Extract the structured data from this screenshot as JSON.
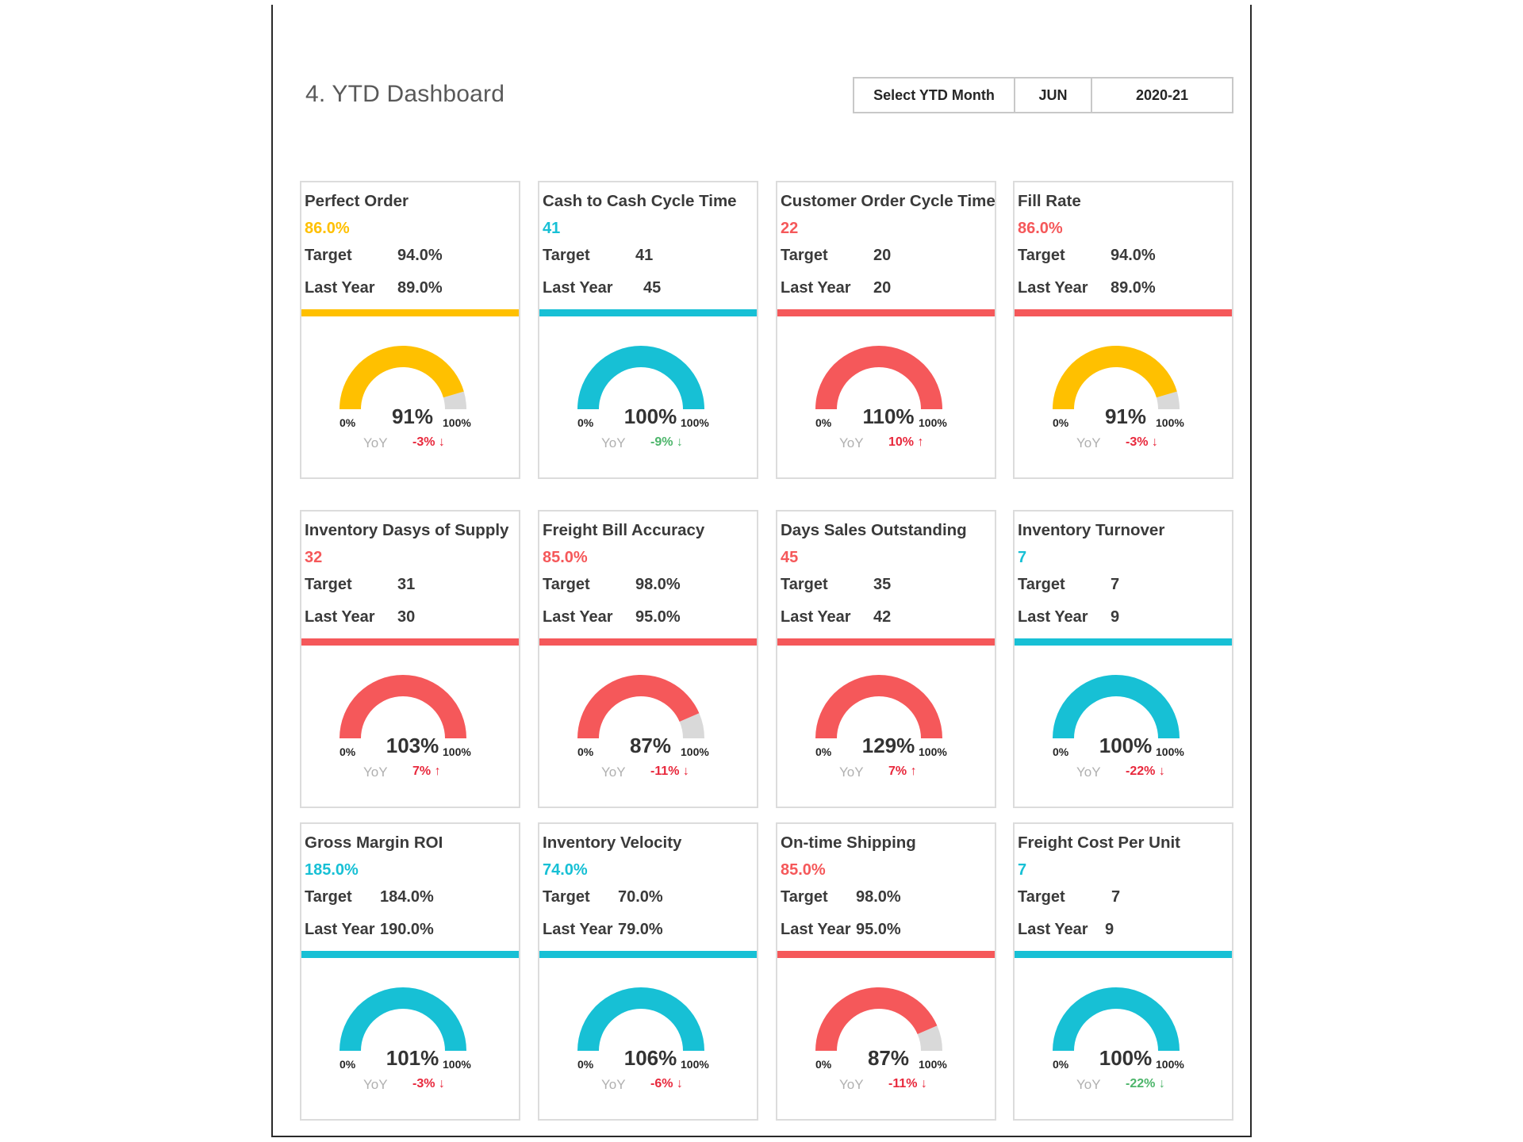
{
  "header": {
    "title": "4. YTD Dashboard"
  },
  "selector": {
    "label": "Select YTD Month",
    "month": "JUN",
    "year": "2020-21"
  },
  "colors": {
    "yellow": "#FFC000",
    "cyan": "#17C0D5",
    "red": "#F5585A",
    "gauge_rest": "#D9D9D9",
    "yoy_bad": "#E8283C",
    "yoy_good": "#4CB56A"
  },
  "labels": {
    "target": "Target",
    "last_year": "Last Year",
    "gauge_min": "0%",
    "gauge_max": "100%",
    "yoy": "YoY"
  },
  "cards": [
    {
      "title": "Perfect Order",
      "value": "86.0%",
      "target": "94.0%",
      "last_year": "89.0%",
      "status": "yellow",
      "gauge_label": "91%",
      "gauge_fraction": 0.91,
      "yoy": "-3%",
      "yoy_arrow": "down",
      "yoy_status": "bad"
    },
    {
      "title": "Cash to Cash Cycle Time",
      "value": "41",
      "target": "41",
      "last_year": "45",
      "status": "cyan",
      "gauge_label": "100%",
      "gauge_fraction": 1.0,
      "yoy": "-9%",
      "yoy_arrow": "down",
      "yoy_status": "good"
    },
    {
      "title": "Customer Order Cycle Time",
      "value": "22",
      "target": "20",
      "last_year": "20",
      "status": "red",
      "gauge_label": "110%",
      "gauge_fraction": 1.1,
      "yoy": "10%",
      "yoy_arrow": "up",
      "yoy_status": "bad"
    },
    {
      "title": "Fill Rate",
      "value": "86.0%",
      "target": "94.0%",
      "last_year": "89.0%",
      "status": "red",
      "gauge_color": "yellow",
      "gauge_label": "91%",
      "gauge_fraction": 0.91,
      "yoy": "-3%",
      "yoy_arrow": "down",
      "yoy_status": "bad"
    },
    {
      "title": "Inventory Dasys of Supply",
      "value": "32",
      "target": "31",
      "last_year": "30",
      "status": "red",
      "gauge_label": "103%",
      "gauge_fraction": 1.03,
      "yoy": "7%",
      "yoy_arrow": "up",
      "yoy_status": "bad"
    },
    {
      "title": "Freight Bill Accuracy",
      "value": "85.0%",
      "target": "98.0%",
      "last_year": "95.0%",
      "status": "red",
      "gauge_label": "87%",
      "gauge_fraction": 0.87,
      "yoy": "-11%",
      "yoy_arrow": "down",
      "yoy_status": "bad"
    },
    {
      "title": "Days Sales Outstanding",
      "value": "45",
      "target": "35",
      "last_year": "42",
      "status": "red",
      "gauge_label": "129%",
      "gauge_fraction": 1.29,
      "yoy": "7%",
      "yoy_arrow": "up",
      "yoy_status": "bad"
    },
    {
      "title": "Inventory Turnover",
      "value": "7",
      "target": "7",
      "last_year": "9",
      "status": "cyan",
      "gauge_label": "100%",
      "gauge_fraction": 1.0,
      "yoy": "-22%",
      "yoy_arrow": "down",
      "yoy_status": "bad"
    },
    {
      "title": "Gross Margin ROI",
      "value": "185.0%",
      "target": "184.0%",
      "last_year": "190.0%",
      "status": "cyan",
      "gauge_label": "101%",
      "gauge_fraction": 1.01,
      "yoy": "-3%",
      "yoy_arrow": "down",
      "yoy_status": "bad"
    },
    {
      "title": "Inventory Velocity",
      "value": "74.0%",
      "target": "70.0%",
      "last_year": "79.0%",
      "status": "cyan",
      "gauge_label": "106%",
      "gauge_fraction": 1.06,
      "yoy": "-6%",
      "yoy_arrow": "down",
      "yoy_status": "bad"
    },
    {
      "title": "On-time Shipping",
      "value": "85.0%",
      "target": "98.0%",
      "last_year": "95.0%",
      "status": "red",
      "gauge_label": "87%",
      "gauge_fraction": 0.87,
      "yoy": "-11%",
      "yoy_arrow": "down",
      "yoy_status": "bad"
    },
    {
      "title": "Freight Cost Per Unit",
      "value": "7",
      "target": "7",
      "last_year": "9",
      "status": "cyan",
      "gauge_label": "100%",
      "gauge_fraction": 1.0,
      "yoy": "-22%",
      "yoy_arrow": "down",
      "yoy_status": "good"
    }
  ]
}
